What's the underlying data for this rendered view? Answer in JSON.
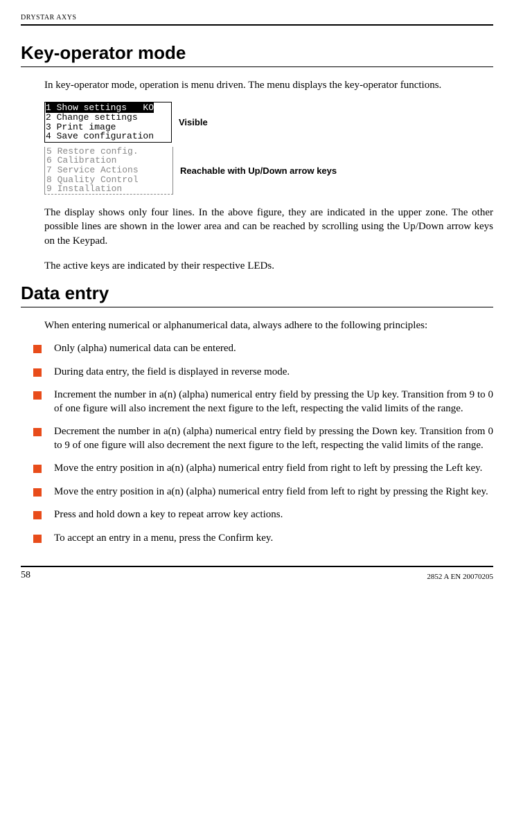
{
  "running_head": "DRYSTAR AXYS",
  "section1": {
    "title": "Key-operator mode",
    "para1": "In key-operator mode, operation is menu driven. The menu displays the key-operator functions.",
    "lcd_visible": {
      "line1_a": "1 ",
      "line1_b": "Show settings   KO",
      "line2": "2 Change settings",
      "line3": "3 Print image",
      "line4": "4 Save configuration"
    },
    "lcd_hidden": {
      "line5": "5 Restore config.",
      "line6": "6 Calibration",
      "line7": "7 Service Actions",
      "line8": "8 Quality Control",
      "line9": "9 Installation"
    },
    "annot_visible": "Visible",
    "annot_hidden": "Reachable with Up/Down arrow keys",
    "para2": "The display shows only four lines. In the above figure, they are indicated in the upper zone. The other possible lines are shown in the lower area and can be reached by scrolling using the Up/Down arrow keys on the Keypad.",
    "para3": "The active keys are indicated by their respective LEDs."
  },
  "section2": {
    "title": "Data entry",
    "intro": "When entering numerical or alphanumerical data, always adhere to the following principles:",
    "items": [
      "Only (alpha) numerical data can be entered.",
      "During data entry, the field is displayed in reverse mode.",
      "Increment the number in a(n) (alpha) numerical entry field by pressing the Up key. Transition from 9 to 0 of one figure will also increment the next figure to the left, respecting the valid limits of the range.",
      "Decrement the number in a(n) (alpha) numerical entry field by pressing the Down key. Transition from 0 to 9 of one figure will also decrement the next figure to the left, respecting the valid limits of the range.",
      "Move the entry position in a(n) (alpha) numerical entry field from right to left by pressing the Left key.",
      "Move the entry position in a(n) (alpha) numerical entry field from left to right by pressing the Right key.",
      "Press and hold down a key to repeat arrow key actions.",
      "To accept an entry in a menu, press the Confirm key."
    ]
  },
  "footer": {
    "page": "58",
    "docid": "2852 A EN 20070205"
  }
}
